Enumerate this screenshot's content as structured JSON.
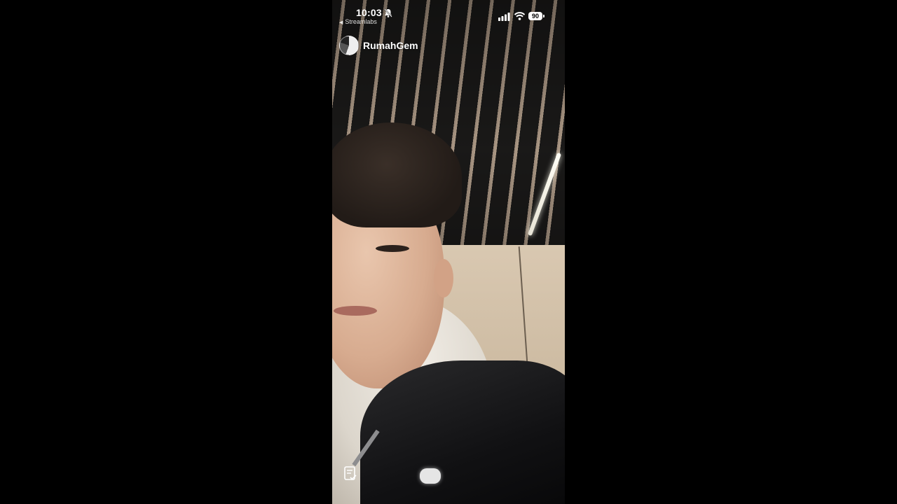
{
  "status_bar": {
    "time": "10:03",
    "back_app": "Streamlabs",
    "battery": "90"
  },
  "stream": {
    "channel_name": "RumahGem"
  },
  "icons": {
    "bell": "bell-slash-icon",
    "signal": "cellular-signal-icon",
    "wifi": "wifi-icon",
    "note": "note-check-icon"
  }
}
